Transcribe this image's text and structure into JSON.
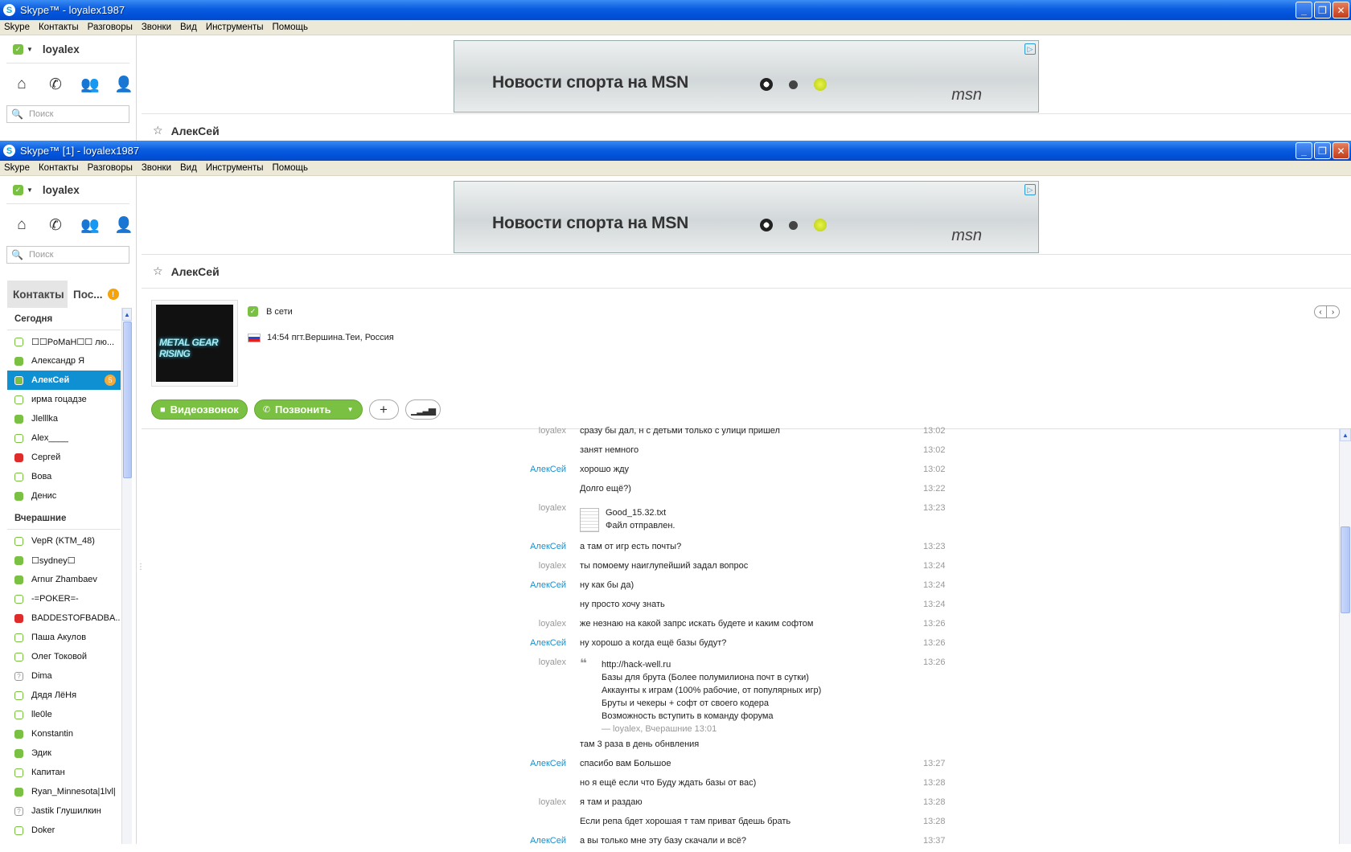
{
  "back_window": {
    "title": "Skype™ - loyalex1987",
    "menu": [
      "Skype",
      "Контакты",
      "Разговоры",
      "Звонки",
      "Вид",
      "Инструменты",
      "Помощь"
    ],
    "user": "loyalex",
    "search_placeholder": "Поиск",
    "ad_headline": "Новости спорта на MSN",
    "ad_logo": "msn",
    "contact_name": "АлекСей"
  },
  "front_window": {
    "title": "Skype™ [1] - loyalex1987",
    "menu": [
      "Skype",
      "Контакты",
      "Разговоры",
      "Звонки",
      "Вид",
      "Инструменты",
      "Помощь"
    ],
    "user": "loyalex",
    "search_placeholder": "Поиск",
    "ad_headline": "Новости спорта на MSN",
    "ad_logo": "msn",
    "contact_name": "АлекСей",
    "tabs": {
      "contacts": "Контакты",
      "recent": "Пос...",
      "recent_badge": "!"
    },
    "groups": [
      {
        "label": "Сегодня",
        "items": [
          {
            "name": "☐☐PoMaH☐☐ лю...",
            "status": "offline"
          },
          {
            "name": "Александр Я",
            "status": "online"
          },
          {
            "name": "АлекСей",
            "status": "online",
            "selected": true,
            "badge": "5"
          },
          {
            "name": "ирма гоцадзе",
            "status": "offline"
          },
          {
            "name": "Jlelllka",
            "status": "online"
          },
          {
            "name": "Alex____",
            "status": "offline"
          },
          {
            "name": "Сергей",
            "status": "busy"
          },
          {
            "name": "Вова",
            "status": "offline"
          },
          {
            "name": "Денис",
            "status": "online"
          }
        ]
      },
      {
        "label": "Вчерашние",
        "items": [
          {
            "name": "VepR (KTM_48)",
            "status": "offline"
          },
          {
            "name": "☐sydney☐",
            "status": "online"
          },
          {
            "name": "Arnur Zhambaev",
            "status": "online"
          },
          {
            "name": "-=POKER=-",
            "status": "offline"
          },
          {
            "name": "BADDESTOFBADBA...",
            "status": "busy"
          },
          {
            "name": "Паша Акулов",
            "status": "offline"
          },
          {
            "name": "Олег Токовой",
            "status": "offline"
          },
          {
            "name": "Dima",
            "status": "unknown"
          },
          {
            "name": "Дядя ЛёНя",
            "status": "offline"
          },
          {
            "name": "lle0le",
            "status": "offline"
          },
          {
            "name": "Konstantin",
            "status": "online"
          },
          {
            "name": "Эдик",
            "status": "online"
          },
          {
            "name": "Капитан",
            "status": "offline"
          },
          {
            "name": "Ryan_Minnesota|1lvl|",
            "status": "online"
          },
          {
            "name": "Jastik Глушилкин",
            "status": "unknown"
          },
          {
            "name": "Doker",
            "status": "offline"
          }
        ]
      }
    ],
    "profile": {
      "status": "В сети",
      "location": "14:54 пгт.Вершина.Теи, Россия",
      "avatar_text": "METAL GEAR RISING"
    },
    "buttons": {
      "video": "Видеозвонок",
      "call": "Позвонить"
    },
    "messages": [
      {
        "who": "loyalex",
        "text": "сразу бы дал, н с детьми только с улици пришел",
        "time": "13:02"
      },
      {
        "who": "",
        "text": "занят немного",
        "time": "13:02"
      },
      {
        "who": "АлекСей",
        "text": "хорошо жду",
        "time": "13:02"
      },
      {
        "who": "",
        "text": "Долго ещё?)",
        "time": "13:22"
      },
      {
        "who": "loyalex",
        "text": "",
        "time": "13:23"
      },
      {
        "who": "АлекСей",
        "text": "а там от игр есть почты?",
        "time": "13:23"
      },
      {
        "who": "loyalex",
        "text": "ты помоему наиглупейший задал вопрос",
        "time": "13:24"
      },
      {
        "who": "АлекСей",
        "text": "ну как бы да)",
        "time": "13:24"
      },
      {
        "who": "",
        "text": "ну просто хочу знать",
        "time": "13:24"
      },
      {
        "who": "loyalex",
        "text": " же незнаю на какой запрс искать будете и каким софтом",
        "time": "13:26"
      },
      {
        "who": "АлекСей",
        "text": "ну хорошо а когда ещё базы будут?",
        "time": "13:26"
      },
      {
        "who": "loyalex",
        "text": "",
        "time": "13:26"
      },
      {
        "who": "",
        "text": "там 3 раза в день обнвления",
        "time": ""
      },
      {
        "who": "АлекСей",
        "text": "спасибо вам Большое",
        "time": "13:27"
      },
      {
        "who": "",
        "text": "но я ещё если что Буду ждать базы от вас)",
        "time": "13:28"
      },
      {
        "who": "loyalex",
        "text": "я там и раздаю",
        "time": "13:28"
      },
      {
        "who": "",
        "text": "Если репа бдет хорошая т там приват бдешь брать",
        "time": "13:28"
      },
      {
        "who": "АлекСей",
        "text": "а вы только мне эту базу скачали и всё?",
        "time": "13:37"
      }
    ],
    "file": {
      "name": "Good_15.32.txt",
      "status": "Файл отправлен."
    },
    "quote": {
      "lines": [
        "http://hack-well.ru",
        "Базы для брута (Более полумилиона почт в сутки)",
        "Аккаунты к играм (100% рабочие, от популярных игр)",
        "Бруты и чекеры + софт от своего кодера",
        "Возможность вступить в команду форума"
      ],
      "signature": "— loyalex, Вчерашние 13:01"
    }
  }
}
